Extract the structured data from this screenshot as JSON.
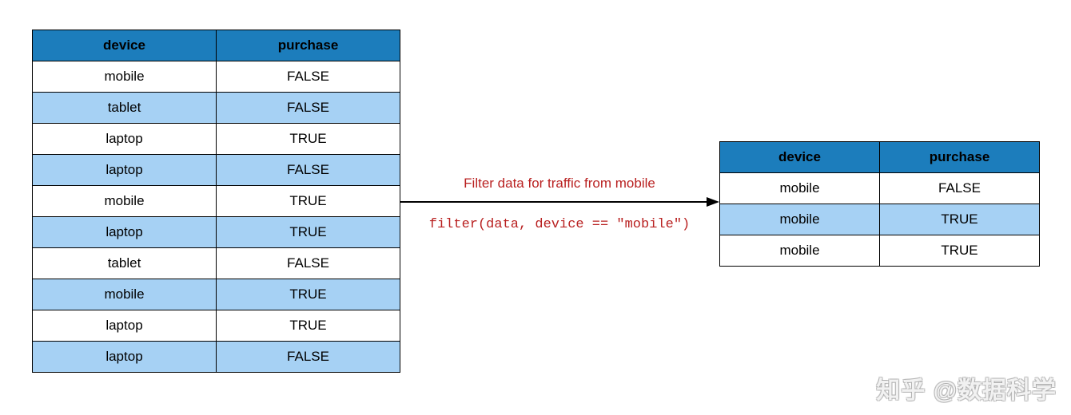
{
  "left_table": {
    "headers": [
      "device",
      "purchase"
    ],
    "rows": [
      [
        "mobile",
        "FALSE"
      ],
      [
        "tablet",
        "FALSE"
      ],
      [
        "laptop",
        "TRUE"
      ],
      [
        "laptop",
        "FALSE"
      ],
      [
        "mobile",
        "TRUE"
      ],
      [
        "laptop",
        "TRUE"
      ],
      [
        "tablet",
        "FALSE"
      ],
      [
        "mobile",
        "TRUE"
      ],
      [
        "laptop",
        "TRUE"
      ],
      [
        "laptop",
        "FALSE"
      ]
    ]
  },
  "right_table": {
    "headers": [
      "device",
      "purchase"
    ],
    "rows": [
      [
        "mobile",
        "FALSE"
      ],
      [
        "mobile",
        "TRUE"
      ],
      [
        "mobile",
        "TRUE"
      ]
    ]
  },
  "arrow": {
    "label": "Filter data for traffic from mobile",
    "code": "filter(data, device == \"mobile\")"
  },
  "watermark": "知乎 @数据科学",
  "colors": {
    "header_bg": "#1c7dbc",
    "row_alt_bg": "#a6d1f4",
    "arrow_text": "#b92121"
  }
}
